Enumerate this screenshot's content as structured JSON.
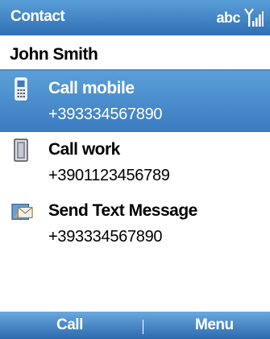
{
  "title_bar": {
    "title": "Contact",
    "input_mode": "abc",
    "signal_icon": "signal-strength-icon"
  },
  "contact": {
    "name": "John Smith"
  },
  "actions": [
    {
      "label": "Call mobile",
      "number": "+393334567890",
      "icon": "mobile-phone-icon",
      "selected": true
    },
    {
      "label": "Call work",
      "number": "+3901123456789",
      "icon": "work-phone-icon",
      "selected": false
    },
    {
      "label": "Send Text Message",
      "number": "+393334567890",
      "icon": "text-message-icon",
      "selected": false
    }
  ],
  "softkeys": {
    "left": "Call",
    "right": "Menu"
  },
  "colors": {
    "title_bar": "#3f83c6",
    "selection": "#4a8ccc",
    "softkey_bar": "#3c7bbf",
    "text": "#000000",
    "background": "#ffffff"
  }
}
